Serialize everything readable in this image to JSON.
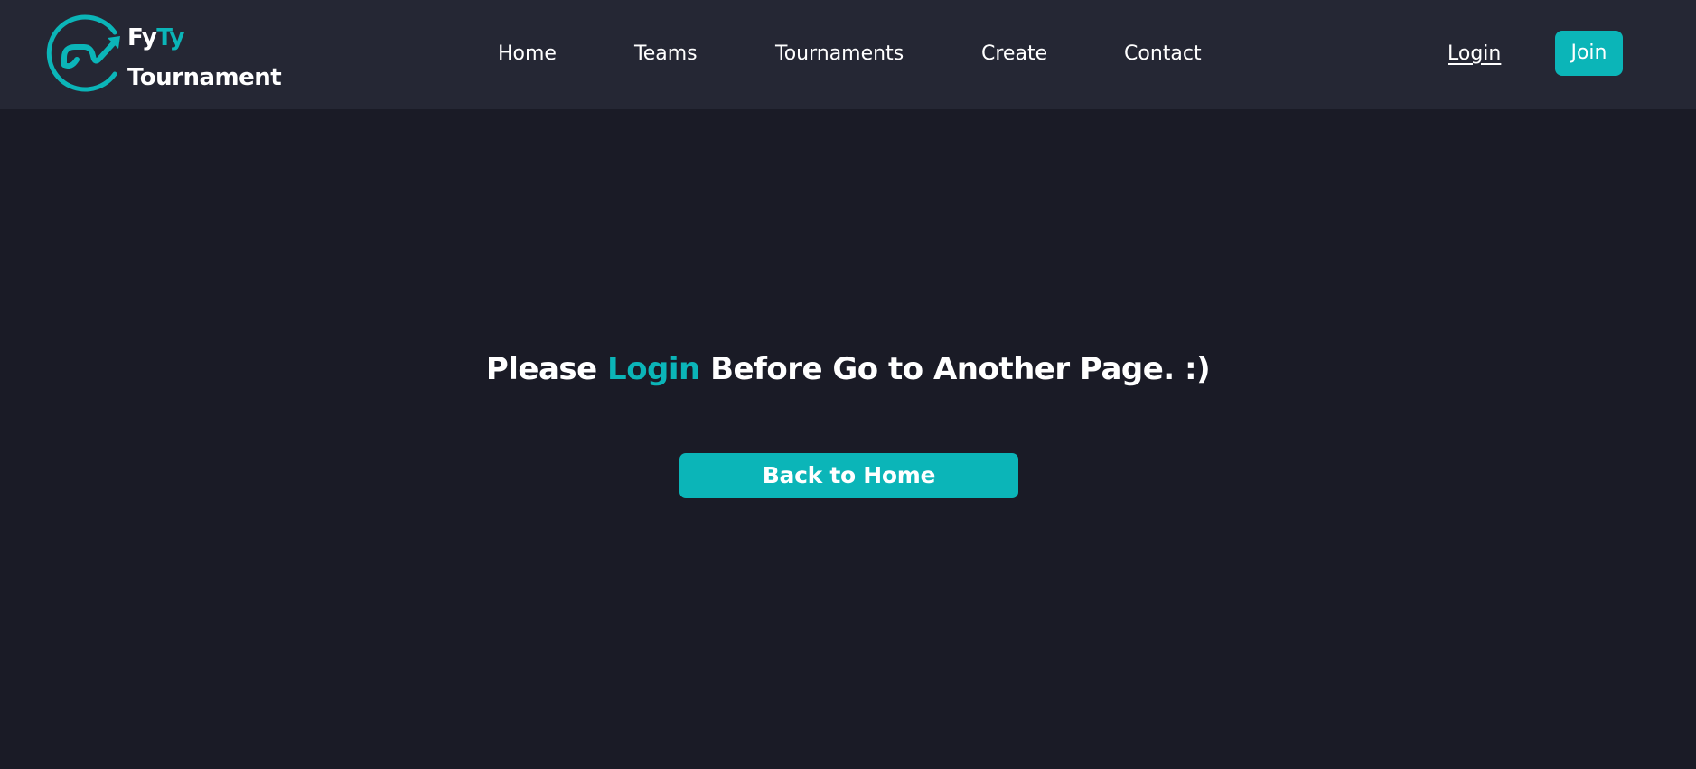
{
  "brand": {
    "name_part1": "Fy",
    "name_part2": "Ty",
    "name_line2": "Tournament",
    "accent_color": "#0bb5b8"
  },
  "nav": {
    "items": [
      {
        "label": "Home"
      },
      {
        "label": "Teams"
      },
      {
        "label": "Tournaments"
      },
      {
        "label": "Create"
      },
      {
        "label": "Contact"
      }
    ]
  },
  "auth": {
    "login_label": "Login",
    "join_label": "Join"
  },
  "main": {
    "message_before": "Please ",
    "message_accent": "Login",
    "message_after": " Before Go to Another Page. :)",
    "back_button_label": "Back to Home"
  },
  "colors": {
    "background": "#1a1b26",
    "header": "#252734",
    "accent": "#0bb5b8"
  },
  "icons": {
    "logo": "gamepad-trend-icon"
  }
}
